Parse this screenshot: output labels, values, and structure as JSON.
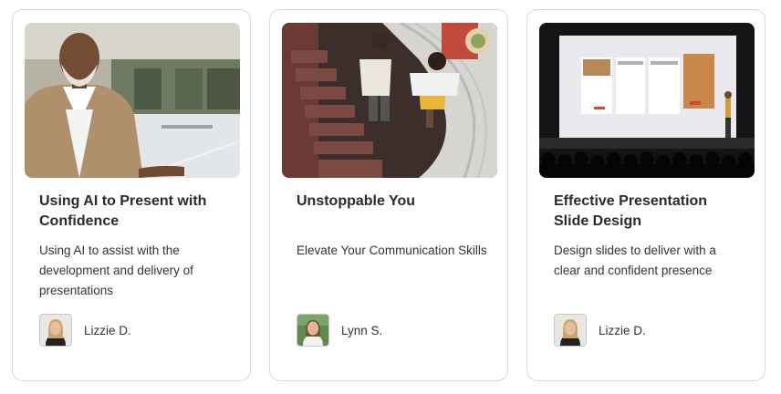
{
  "cards": [
    {
      "title": "Using AI to Present with Confidence",
      "description": "Using AI to assist with the development and delivery of presentations",
      "author": "Lizzie D."
    },
    {
      "title": "Unstoppable You",
      "description": "Elevate Your Communication Skills",
      "author": "Lynn S."
    },
    {
      "title": "Effective Presentation Slide Design",
      "description": "Design slides to deliver with a clear and confident presence",
      "author": "Lizzie D."
    }
  ]
}
